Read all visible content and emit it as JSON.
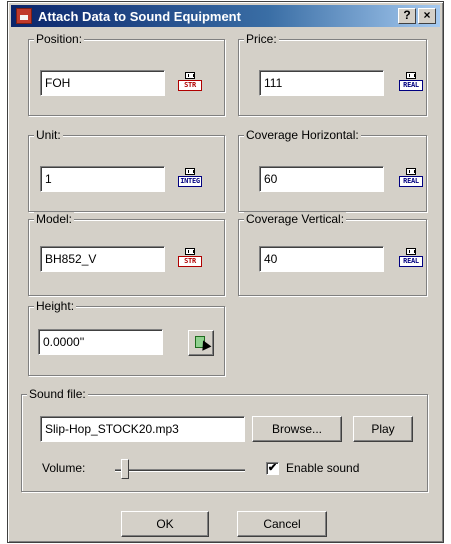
{
  "window": {
    "title": "Attach Data to Sound Equipment",
    "help_glyph": "?",
    "close_glyph": "×"
  },
  "fields": {
    "position": {
      "label": "Position:",
      "value": "FOH",
      "type_badge": "STR"
    },
    "price": {
      "label": "Price:",
      "value": "111",
      "type_badge": "REAL"
    },
    "unit": {
      "label": "Unit:",
      "value": "1",
      "type_badge": "INTEG"
    },
    "coverage_horizontal": {
      "label": "Coverage Horizontal:",
      "value": "60",
      "type_badge": "REAL"
    },
    "model": {
      "label": "Model:",
      "value": "BH852_V",
      "type_badge": "STR"
    },
    "coverage_vertical": {
      "label": "Coverage Vertical:",
      "value": "40",
      "type_badge": "REAL"
    },
    "height": {
      "label": "Height:",
      "value": "0.0000''"
    }
  },
  "sound": {
    "label": "Sound file:",
    "file": "Slip-Hop_STOCK20.mp3",
    "browse_label": "Browse...",
    "play_label": "Play",
    "volume_label": "Volume:",
    "volume_level": 0.05,
    "enable_label": "Enable sound",
    "enable_checked": true,
    "check_glyph": "✔"
  },
  "actions": {
    "ok_label": "OK",
    "cancel_label": "Cancel"
  }
}
